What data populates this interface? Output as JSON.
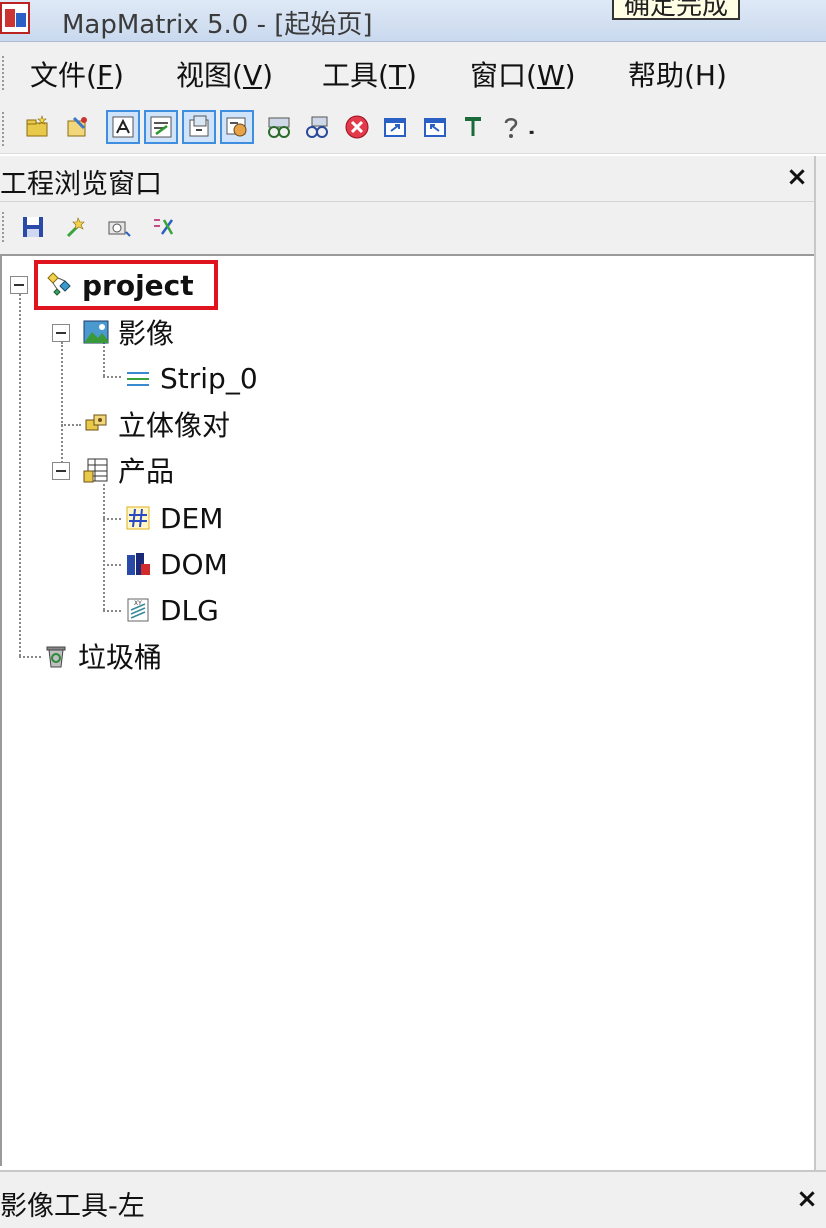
{
  "window": {
    "title": "MapMatrix 5.0 - [起始页]",
    "tooltip": "确定完成"
  },
  "menu": [
    {
      "label": "文件(",
      "key": "F",
      "tail": ")"
    },
    {
      "label": "视图(",
      "key": "V",
      "tail": ")"
    },
    {
      "label": "工具(",
      "key": "T",
      "tail": ")"
    },
    {
      "label": "窗口(",
      "key": "W",
      "tail": ")"
    },
    {
      "label": "帮助(H)",
      "key": "",
      "tail": ""
    }
  ],
  "toolbar_icons": [
    "new-project-icon",
    "open-project-icon",
    "tool-pressed-1-icon",
    "tool-pressed-2-icon",
    "tool-pressed-3-icon",
    "tool-pressed-4-icon",
    "tool-binocular-1-icon",
    "tool-binocular-2-icon",
    "stop-icon",
    "window-1-icon",
    "window-2-icon",
    "pin-icon",
    "help-icon",
    "dropdown-icon"
  ],
  "panel": {
    "title": "工程浏览窗口",
    "close": "×",
    "toolbar_icons": [
      "save-icon",
      "wand-icon",
      "camera-icon",
      "tools-icon"
    ]
  },
  "tree": {
    "root": {
      "label": "project"
    },
    "image": {
      "label": "影像"
    },
    "strip": {
      "label": "Strip_0"
    },
    "stereo": {
      "label": "立体像对"
    },
    "product": {
      "label": "产品"
    },
    "dem": {
      "label": "DEM"
    },
    "dom": {
      "label": "DOM"
    },
    "dlg": {
      "label": "DLG"
    },
    "trash": {
      "label": "垃圾桶"
    }
  },
  "bottom_panel": {
    "title": "影像工具-左",
    "close": "×"
  },
  "colors": {
    "highlight": "#e0141e",
    "pressed_border": "#3f8ee0",
    "titlebar": "#c9d9ee"
  }
}
